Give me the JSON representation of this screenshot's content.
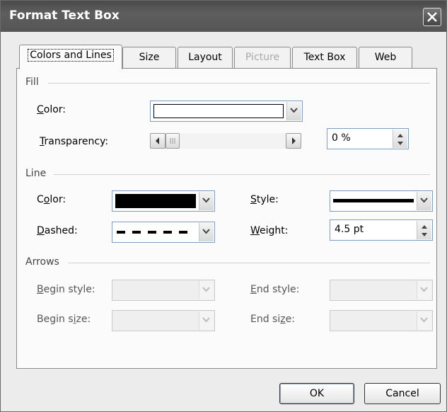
{
  "window": {
    "title": "Format Text Box"
  },
  "tabs": [
    {
      "label": "Colors and Lines"
    },
    {
      "label": "Size"
    },
    {
      "label": "Layout"
    },
    {
      "label": "Picture"
    },
    {
      "label": "Text Box"
    },
    {
      "label": "Web"
    }
  ],
  "fill": {
    "heading": "Fill",
    "color_label": {
      "pre": "",
      "key": "C",
      "post": "olor:"
    },
    "transparency_label": {
      "pre": "",
      "key": "T",
      "post": "ransparency:"
    },
    "transparency_value": "0 %",
    "color_swatch": "#ffffff"
  },
  "line": {
    "heading": "Line",
    "color_label": {
      "pre": "C",
      "key": "o",
      "post": "lor:"
    },
    "color_swatch": "#000000",
    "dashed_label": {
      "pre": "",
      "key": "D",
      "post": "ashed:"
    },
    "style_label": {
      "pre": "",
      "key": "S",
      "post": "tyle:"
    },
    "weight_label": {
      "pre": "",
      "key": "W",
      "post": "eight:"
    },
    "weight_value": "4.5 pt"
  },
  "arrows": {
    "heading": "Arrows",
    "begin_style_label": {
      "pre": "",
      "key": "B",
      "post": "egin style:"
    },
    "begin_size_label": {
      "pre": "Begin s",
      "key": "i",
      "post": "ze:"
    },
    "end_style_label": {
      "pre": "",
      "key": "E",
      "post": "nd style:"
    },
    "end_size_label": {
      "pre": "End si",
      "key": "z",
      "post": "e:"
    }
  },
  "buttons": {
    "ok": "OK",
    "cancel": "Cancel"
  }
}
